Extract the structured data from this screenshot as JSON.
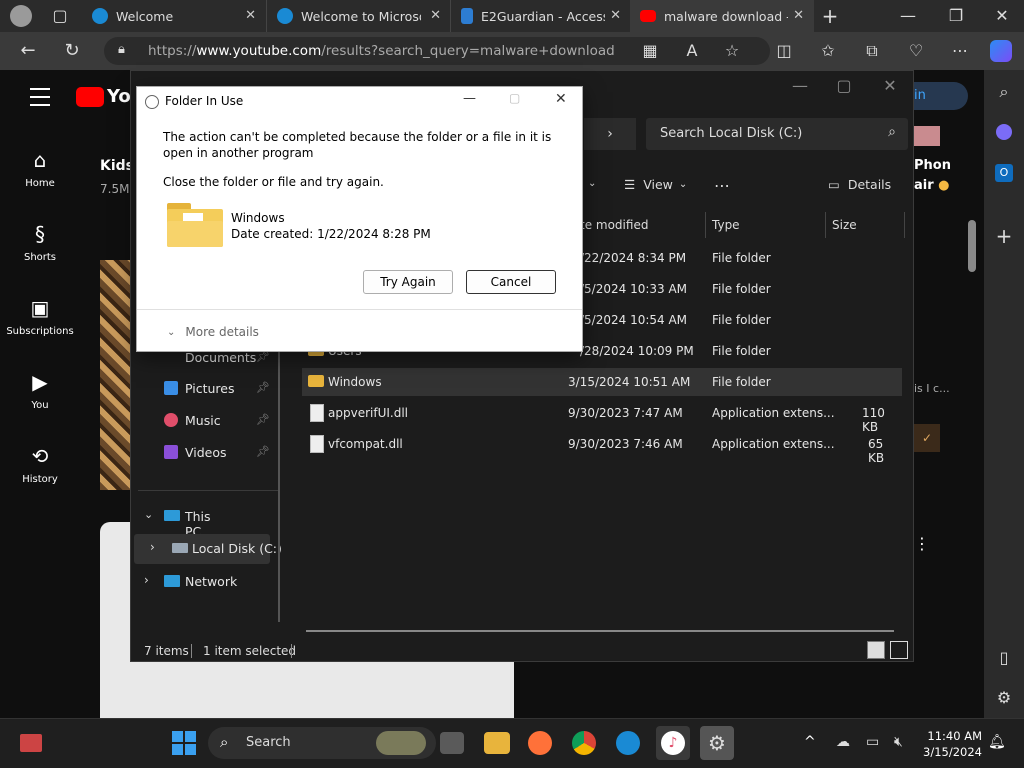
{
  "browser": {
    "tabs": [
      {
        "label": "Welcome",
        "color": "#1da1f2"
      },
      {
        "label": "Welcome to Microsof",
        "color": "#1da1f2"
      },
      {
        "label": "E2Guardian - Access D",
        "color": "#2d7dd2"
      },
      {
        "label": "malware download - Y",
        "color": "#ff0000"
      }
    ],
    "url_prefix": "https://",
    "url_host": "www.youtube.com",
    "url_path": "/results?search_query=malware+download"
  },
  "youtube": {
    "logo": "You",
    "nav": [
      "Home",
      "Shorts",
      "Subscriptions",
      "You",
      "History"
    ],
    "snippet_title": "Kids",
    "snippet_sub": "7.5M",
    "sign_in": "in",
    "right_text1": "Phon",
    "right_text2": "air",
    "right_text3": "is I c..."
  },
  "explorer": {
    "search_placeholder": "Search Local Disk (C:)",
    "view_label": "View",
    "details_label": "Details",
    "columns": [
      "te modified",
      "Type",
      "Size"
    ],
    "rows": [
      {
        "name": "",
        "date": "/22/2024 8:34 PM",
        "type": "File folder",
        "size": "",
        "icon": "folder"
      },
      {
        "name": "",
        "date": "/5/2024 10:33 AM",
        "type": "File folder",
        "size": "",
        "icon": "folder"
      },
      {
        "name": "",
        "date": "/5/2024 10:54 AM",
        "type": "File folder",
        "size": "",
        "icon": "folder"
      },
      {
        "name": "Users",
        "date": "/28/2024 10:09 PM",
        "type": "File folder",
        "size": "",
        "icon": "folder"
      },
      {
        "name": "Windows",
        "date": "3/15/2024 10:51 AM",
        "type": "File folder",
        "size": "",
        "icon": "folder"
      },
      {
        "name": "appverifUI.dll",
        "date": "9/30/2023 7:47 AM",
        "type": "Application extens...",
        "size": "110 KB",
        "icon": "file"
      },
      {
        "name": "vfcompat.dll",
        "date": "9/30/2023 7:46 AM",
        "type": "Application extens...",
        "size": "65 KB",
        "icon": "file"
      }
    ],
    "sidebar": {
      "documents": "Documents",
      "pictures": "Pictures",
      "music": "Music",
      "videos": "Videos",
      "this_pc": "This PC",
      "local_disk": "Local Disk (C:)",
      "network": "Network"
    },
    "status_items": "7 items",
    "status_selected": "1 item selected"
  },
  "dialog": {
    "title": "Folder In Use",
    "message": "The action can't be completed because the folder or a file in it is open in another program",
    "instruction": "Close the folder or file and try again.",
    "item_name": "Windows",
    "item_date": "Date created: 1/22/2024 8:28 PM",
    "try_again": "Try Again",
    "cancel": "Cancel",
    "more_details": "More details"
  },
  "taskbar": {
    "search_label": "Search",
    "time": "11:40 AM",
    "date": "3/15/2024"
  }
}
